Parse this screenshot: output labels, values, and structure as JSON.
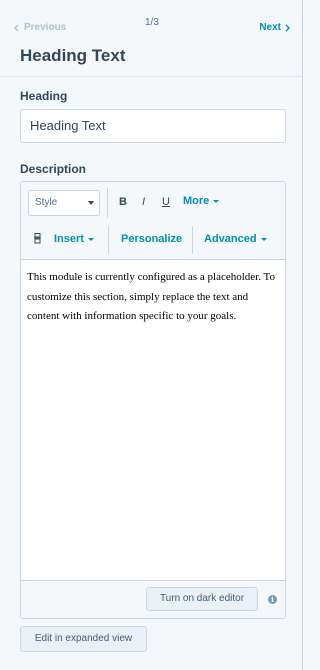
{
  "nav": {
    "previous_label": "Previous",
    "counter": "1/3",
    "next_label": "Next"
  },
  "title": "Heading Text",
  "heading_field": {
    "label": "Heading",
    "value": "Heading Text"
  },
  "description_field": {
    "label": "Description"
  },
  "toolbar": {
    "style_select": "Style",
    "bold": "B",
    "italic": "I",
    "underline": "U",
    "more": "More",
    "insert": "Insert",
    "personalize": "Personalize",
    "advanced": "Advanced"
  },
  "editor_content": "This module is currently configured as a placeholder. To customize this section, simply replace the text and content with information specific to your goals.",
  "editor_footer": {
    "dark_editor_button": "Turn on dark editor",
    "info_icon": "i"
  },
  "expanded_view_button": "Edit in expanded view",
  "colors": {
    "link": "#0091ae",
    "text": "#33475b",
    "disabled": "#b0c1d4",
    "border": "#cbd6e2",
    "background": "#f5f8fa"
  }
}
